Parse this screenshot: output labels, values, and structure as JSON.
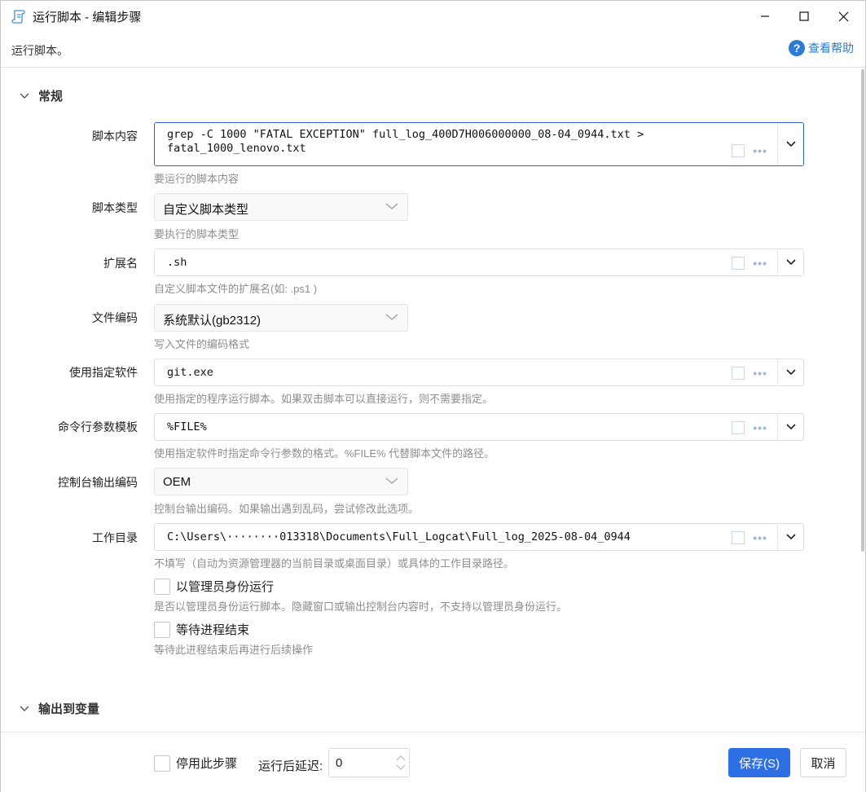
{
  "window": {
    "title": "运行脚本 - 编辑步骤",
    "icon": "script-scroll-icon"
  },
  "description": "运行脚本。",
  "help_label": "查看帮助",
  "sections": {
    "general": "常规",
    "output": "输出到变量"
  },
  "fields": {
    "script_content": {
      "label": "脚本内容",
      "value_line1": "grep -C 1000 \"FATAL EXCEPTION\" full_log_400D7H006000000_08-04_0944.txt >",
      "value_line2": "fatal_1000_lenovo.txt",
      "hint": "要运行的脚本内容"
    },
    "script_type": {
      "label": "脚本类型",
      "value": "自定义脚本类型",
      "hint": "要执行的脚本类型"
    },
    "extension": {
      "label": "扩展名",
      "value": ".sh",
      "hint": "自定义脚本文件的扩展名(如: .ps1 )"
    },
    "encoding": {
      "label": "文件编码",
      "value": "系统默认(gb2312)",
      "hint": "写入文件的编码格式"
    },
    "software": {
      "label": "使用指定软件",
      "value": "git.exe",
      "hint": "使用指定的程序运行脚本。如果双击脚本可以直接运行，则不需要指定。"
    },
    "cmd_template": {
      "label": "命令行参数模板",
      "value": "%FILE%",
      "hint": "使用指定软件时指定命令行参数的格式。%FILE% 代替脚本文件的路径。"
    },
    "console_encoding": {
      "label": "控制台输出编码",
      "value": "OEM",
      "hint": "控制台输出编码。如果输出遇到乱码，尝试修改此选项。"
    },
    "workdir": {
      "label": "工作目录",
      "value": "C:\\Users\\········013318\\Documents\\Full_Logcat\\Full_log_2025-08-04_0944",
      "hint": "不填写（自动为资源管理器的当前目录或桌面目录）或具体的工作目录路径。"
    },
    "run_as_admin": {
      "label": "以管理员身份运行",
      "hint": "是否以管理员身份运行脚本。隐藏窗口或输出控制台内容时，不支持以管理员身份运行。"
    },
    "wait_exit": {
      "label": "等待进程结束",
      "hint": "等待此进程结束后再进行后续操作"
    }
  },
  "footer": {
    "disable_label": "停用此步骤",
    "delay_label": "运行后延迟:",
    "delay_value": "0",
    "save_label": "保存(S)",
    "cancel_label": "取消"
  },
  "colors": {
    "accent": "#2f6fe4",
    "hint": "#8e8e8e",
    "focus_border": "#2d66d6"
  }
}
